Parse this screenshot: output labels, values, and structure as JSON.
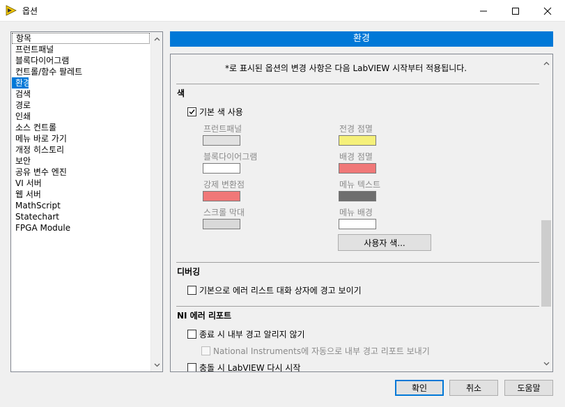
{
  "window": {
    "title": "옵션",
    "icon": "labview-icon"
  },
  "categories": {
    "items": [
      "항목",
      "프런트패널",
      "블록다이어그램",
      "컨트롤/함수 팔레트",
      "환경",
      "검색",
      "경로",
      "인쇄",
      "소스 컨트롤",
      "메뉴 바로 가기",
      "개정 히스토리",
      "보안",
      "공유 변수 엔진",
      "VI 서버",
      "웹 서버",
      "MathScript",
      "Statechart",
      "FPGA Module"
    ],
    "selected": "환경"
  },
  "header": {
    "title": "환경"
  },
  "panel": {
    "note": "*로 표시된 옵션의 변경 사항은 다음 LabVIEW 시작부터 적용됩니다.",
    "color_section": {
      "title": "색",
      "use_default": {
        "label": "기본 색 사용",
        "checked": true
      },
      "swatches": {
        "front_panel": {
          "label": "프런트패널",
          "color": "#e1e1e1"
        },
        "block_diagram": {
          "label": "블록다이어그램",
          "color": "#ffffff"
        },
        "coercion_dot": {
          "label": "강제 변환점",
          "color": "#f07878"
        },
        "scrollbar": {
          "label": "스크롤 막대",
          "color": "#d9d9d9"
        },
        "foreground_blink": {
          "label": "전경 점멸",
          "color": "#f5f07a"
        },
        "background_blink": {
          "label": "배경 점멸",
          "color": "#f07878"
        },
        "menu_text": {
          "label": "메뉴 텍스트",
          "color": "#6e6e6e"
        },
        "menu_background": {
          "label": "메뉴 배경",
          "color": "#ffffff"
        }
      },
      "custom_button": "사용자 색..."
    },
    "debug_section": {
      "title": "디버깅",
      "show_warnings": {
        "label": "기본으로 에러 리스트 대화 상자에 경고 보이기",
        "checked": false
      }
    },
    "error_section": {
      "title": "NI 에러 리포트",
      "no_warn_on_exit": {
        "label": "종료 시 내부 경고 알리지 않기",
        "checked": false
      },
      "auto_send": {
        "label": "National Instruments에 자동으로 내부 경고 리포트 보내기",
        "checked": false
      },
      "restart_on_crash": {
        "label": "충돌 시 LabVIEW 다시 시작",
        "checked": false
      }
    }
  },
  "buttons": {
    "ok": "확인",
    "cancel": "취소",
    "help": "도움말"
  }
}
